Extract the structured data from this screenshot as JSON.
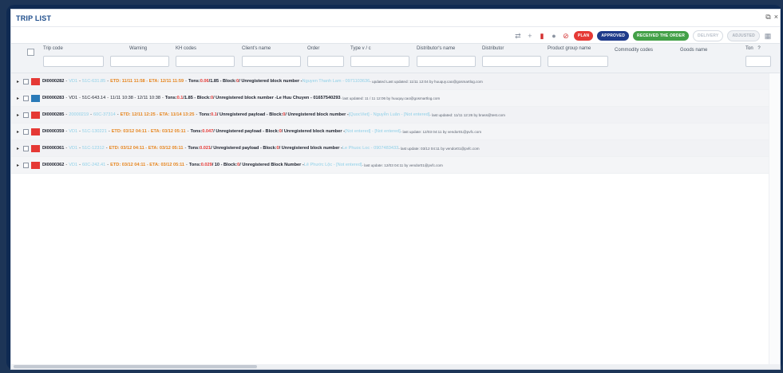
{
  "window": {
    "title": "TRIP LIST",
    "restore_glyph": "⧉",
    "close_glyph": "×"
  },
  "toolbar": {
    "icons": [
      "swap-icon",
      "plus-icon",
      "trash-icon",
      "check-circle-icon",
      "block-icon",
      "calendar-icon"
    ],
    "pills": {
      "plan": "PLAN",
      "approved": "APPROVED",
      "received": "RECEIVED THE ORDER",
      "btn4": "DELIVERY",
      "adjusted": "ADJUSTED"
    }
  },
  "columns": [
    "Trip code",
    "Warning",
    "KH codes",
    "Client's name",
    "Order",
    "Type v / c",
    "Distributor's name",
    "Distributor",
    "Product group name",
    "Commodity codes",
    "Goods name",
    "Ton"
  ],
  "filter_extra": "?",
  "rows": [
    {
      "color": "#e53935",
      "code": "DI0000282",
      "vendor": "VD1",
      "plate": "51C-631.85",
      "etd": "ETD: 11/11 11:58 - ETA: 12/11 11:59",
      "tons_prefix": "Tons: ",
      "tons": "0.06",
      "tons_suffix": " /1.85 - Block: ",
      "block": "0",
      "desc": " / Unregistered block number - ",
      "driver": "Nguyen Thanh Lam - 0971103636",
      "meta": " - updated Last updated: 11/11 12:04 by huuquy.cao@gosmartlog.com",
      "dark": false
    },
    {
      "color": "#2a7ab8",
      "code": "DI0000283",
      "vendor": "VD1",
      "plate": "51C-643.14",
      "etd": "11/11 10:38 - 12/11 10:38",
      "tons_prefix": "Tons: ",
      "tons": "0.1",
      "tons_suffix": " /1.85 - Block: ",
      "block": "0",
      "desc": " / Unregistered block number - ",
      "driver": "Le Huu Chuyen - 01657540293",
      "meta": " - last updated: 11 / 11 12:06 by huuquy.cao@gosmartlog.com",
      "dark": true
    },
    {
      "color": "#e53935",
      "code": "DI0000285",
      "vendor": "20000219",
      "plate": "60C-37314",
      "etd": "ETD: 12/11 12:25 - ETA: 11/14 13:25",
      "tons_prefix": "Tons: ",
      "tons": "0.1",
      "tons_suffix": " / Unregistered payload - Block: ",
      "block": "0",
      "desc": " / Unregistered block number - ",
      "driver": "[QuocViet] - Nguyễn Luân - [Not entered]",
      "meta": " - last updated: 11/11 12:26 by brass@test.com",
      "dark": false
    },
    {
      "color": "#e53935",
      "code": "DI0000359",
      "vendor": "VD1",
      "plate": "51C-130221",
      "etd": "ETD: 03/12 04:11 - ETA: 03/12 05:11",
      "tons_prefix": "Tons: ",
      "tons": "0.047",
      "tons_suffix": " / Unregistered payload - Block: ",
      "block": "0",
      "desc": " / Unregistered block number - ",
      "driver": "[Not entered] - [Not entered]",
      "meta": " - last update: 12/03 04:11 by vendor01@pvfc.com",
      "dark": false
    },
    {
      "color": "#e53935",
      "code": "DI0000361",
      "vendor": "VD1",
      "plate": "51C-12312",
      "etd": "ETD: 03/12 04:11 - ETA: 03/12 05:11",
      "tons_prefix": "Tons: ",
      "tons": "0.021",
      "tons_suffix": " / Unregistered payload - Block: ",
      "block": "0",
      "desc": " / Unregistered block number - ",
      "driver": "Le Phuoc Loc - 0907483433",
      "meta": " - last update: 03/12 04:11 by vendor01@pvfc.com",
      "dark": false
    },
    {
      "color": "#e53935",
      "code": "DI0000362",
      "vendor": "VD1",
      "plate": "60C-242.41",
      "etd": "ETD: 03/12 04:11 - ETA: 03/12 05:11",
      "tons_prefix": "Tons: ",
      "tons": "0.029",
      "tons_suffix": " / 10 - Block: ",
      "block": "0",
      "desc": " / Unregistered Block Number - ",
      "driver": "Lê Phước Lộc - [Not entered]",
      "meta": " - last update: 12/03 04:11 by vendor01@pvfc.com",
      "dark": false
    }
  ]
}
